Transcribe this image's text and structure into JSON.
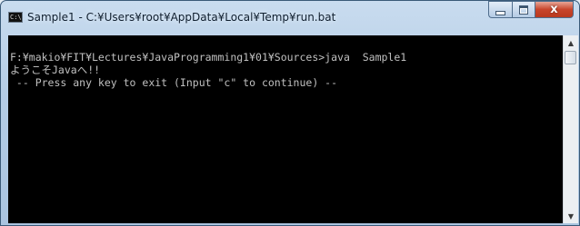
{
  "window": {
    "title": "Sample1 - C:¥Users¥root¥AppData¥Local¥Temp¥run.bat",
    "icon_label": "C:\\",
    "icon": "console-window-icon"
  },
  "controls": {
    "minimize": "minimize-icon",
    "maximize": "maximize-icon",
    "close_glyph": "x"
  },
  "console": {
    "lines": [
      "F:¥makio¥FIT¥Lectures¥JavaProgramming1¥01¥Sources>java  Sample1",
      "ようこそJavaへ!!",
      " -- Press any key to exit (Input \"c\" to continue) --"
    ],
    "text_color": "#c0c0c0",
    "background": "#000000"
  },
  "scrollbar": {
    "up": "▲",
    "down": "▼"
  }
}
